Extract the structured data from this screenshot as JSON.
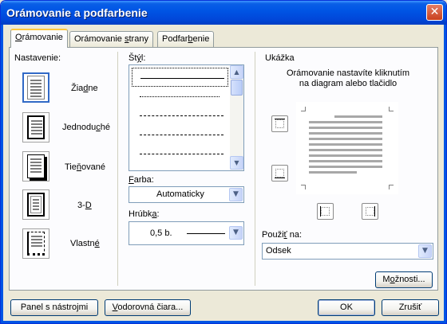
{
  "window": {
    "title": "Orámovanie a podfarbenie",
    "close_glyph": "✕"
  },
  "tabs": [
    {
      "pre": "",
      "acc": "O",
      "post": "rámovanie",
      "active": true
    },
    {
      "pre": "Orámovanie ",
      "acc": "s",
      "post": "trany",
      "active": false
    },
    {
      "pre": "Podfar",
      "acc": "b",
      "post": "enie",
      "active": false
    }
  ],
  "setting": {
    "heading": "Nastavenie:",
    "options": [
      {
        "pre": "Žia",
        "acc": "d",
        "post": "ne",
        "icon": "border-none-icon"
      },
      {
        "pre": "Jednodu",
        "acc": "c",
        "post": "hé",
        "icon": "border-box-icon"
      },
      {
        "pre": "Tie",
        "acc": "ň",
        "post": "ované",
        "icon": "border-shadow-icon"
      },
      {
        "pre": "3-",
        "acc": "D",
        "post": "",
        "icon": "border-3d-icon"
      },
      {
        "pre": "Vlastn",
        "acc": "é",
        "post": "",
        "icon": "border-custom-icon"
      }
    ]
  },
  "style": {
    "heading_pre": "Št",
    "heading_acc": "ý",
    "heading_post": "l:",
    "color_label_pre": "",
    "color_label_acc": "F",
    "color_label_post": "arba:",
    "color_value": "Automaticky",
    "width_label_pre": "Hrúbk",
    "width_label_acc": "a",
    "width_label_post": ":",
    "width_value": "0,5 b."
  },
  "preview": {
    "heading": "Ukážka",
    "instruction_line1": "Orámovanie nastavíte kliknutím",
    "instruction_line2": "na diagram alebo tlačidlo",
    "apply_label_pre": "Použi",
    "apply_label_acc": "ť",
    "apply_label_post": " na:",
    "apply_value": "Odsek",
    "options_btn_pre": "M",
    "options_btn_acc": "o",
    "options_btn_post": "žnosti..."
  },
  "footer": {
    "toolbar_btn": "Panel s nástrojmi",
    "hline_btn_pre": "",
    "hline_btn_acc": "V",
    "hline_btn_post": "odorovná čiara...",
    "ok": "OK",
    "cancel": "Zrušiť"
  },
  "colors": {
    "title_bar": "#0055e5",
    "face": "#ece9d8",
    "active_tab_accent": "#ffc73c"
  }
}
